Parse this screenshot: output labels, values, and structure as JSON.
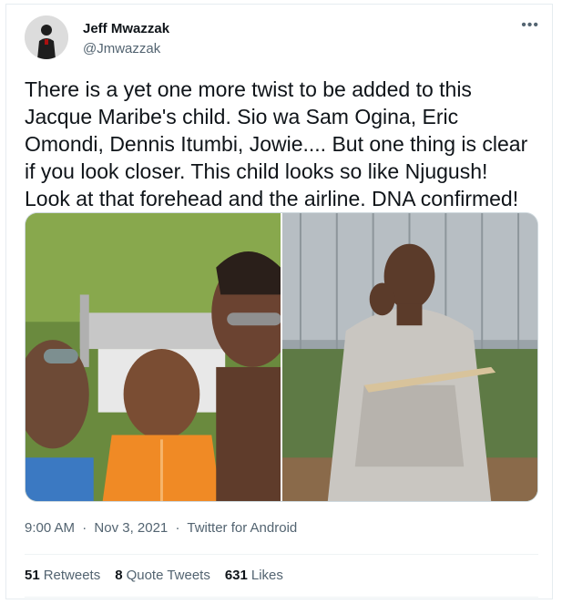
{
  "user": {
    "name": "Jeff Mwazzak",
    "handle": "@Jmwazzak"
  },
  "tweet": {
    "text": "There is a yet one more twist to be added to this Jacque Maribe's child. Sio wa Sam Ogina, Eric Omondi, Dennis Itumbi, Jowie.... But one thing is clear if you look closer. This child looks so like Njugush! Look at that forehead and the airline. DNA confirmed!",
    "time": "9:00 AM",
    "date": "Nov 3, 2021",
    "source": "Twitter for Android",
    "separator": "·"
  },
  "stats": {
    "retweets_count": "51",
    "retweets_label": "Retweets",
    "quotes_count": "8",
    "quotes_label": "Quote Tweets",
    "likes_count": "631",
    "likes_label": "Likes"
  },
  "icons": {
    "more": "more-options-icon"
  },
  "colors": {
    "text": "#0f1419",
    "secondary": "#536471",
    "border": "#e6ecf0"
  }
}
